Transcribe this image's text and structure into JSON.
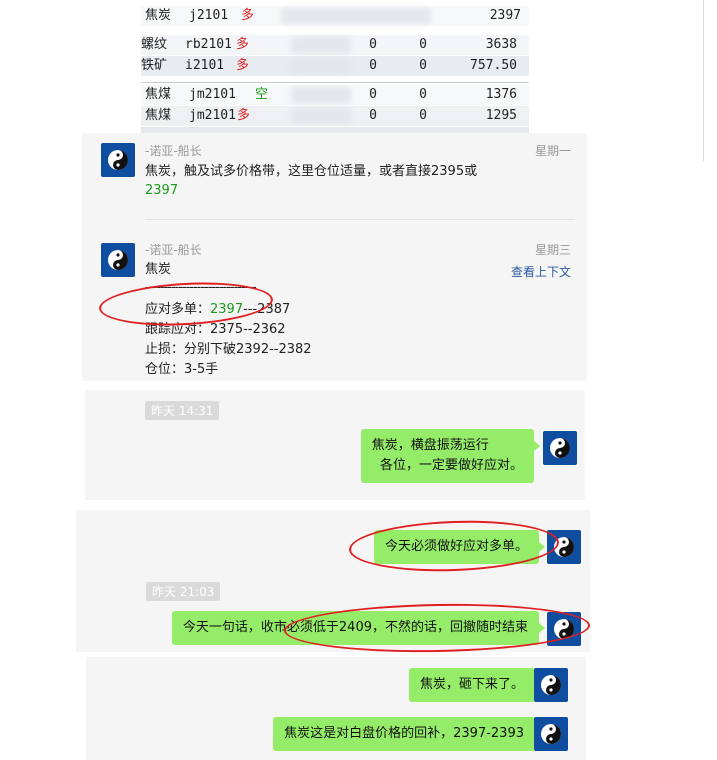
{
  "quotes": [
    {
      "name": "焦炭",
      "code": "j2101",
      "dir": "多",
      "dir_type": "long",
      "vals": [
        "",
        "",
        "2397"
      ]
    },
    {
      "name": "螺纹",
      "code": "rb2101",
      "dir": "多",
      "dir_type": "long",
      "vals": [
        "0",
        "0",
        "3638"
      ]
    },
    {
      "name": "铁矿",
      "code": "i2101",
      "dir": "多",
      "dir_type": "long",
      "vals": [
        "0",
        "0",
        "757.50"
      ]
    },
    {
      "name": "焦煤",
      "code": "jm2101",
      "dir": "空",
      "dir_type": "short",
      "vals": [
        "0",
        "0",
        "1376"
      ]
    },
    {
      "name": "焦煤",
      "code": "jm2101",
      "dir": "多",
      "dir_type": "long",
      "vals": [
        "0",
        "0",
        "1295"
      ]
    }
  ],
  "post1": {
    "sender": "-诺亚-船长",
    "day": "星期一",
    "line1": "焦炭，触及试多价格带，这里仓位适量，或者直接2395或",
    "line2": "2397"
  },
  "post2": {
    "sender": "-诺亚-船长",
    "day": "星期三",
    "link": "查看上下文",
    "title": "焦炭",
    "divider": "------------------------------",
    "long_label": "应对多单：",
    "long_from": "2397",
    "long_to": "---2387",
    "follow": "跟踪应对：2375--2362",
    "stop": "止损：分别下破2392--2382",
    "position": "仓位：3-5手"
  },
  "chat1": {
    "time": "昨天 14:31",
    "bubble": "焦炭，横盘振荡运行\n  各位，一定要做好应对。"
  },
  "chat2": {
    "bubble1": "今天必须做好应对多单。",
    "time": "昨天 21:03",
    "bubble2": "今天一句话，收市必须低于2409，不然的话，回撤随时结束"
  },
  "chat3": {
    "bubble1": "焦炭，砸下来了。",
    "bubble2": "焦炭这是对白盘价格的回补，2397-2393"
  },
  "colors": {
    "bubble": "#95ec69",
    "avatar": "#0e4da0",
    "annotation": "#e02020",
    "long": "#d22222",
    "short": "#1a9a1a"
  }
}
